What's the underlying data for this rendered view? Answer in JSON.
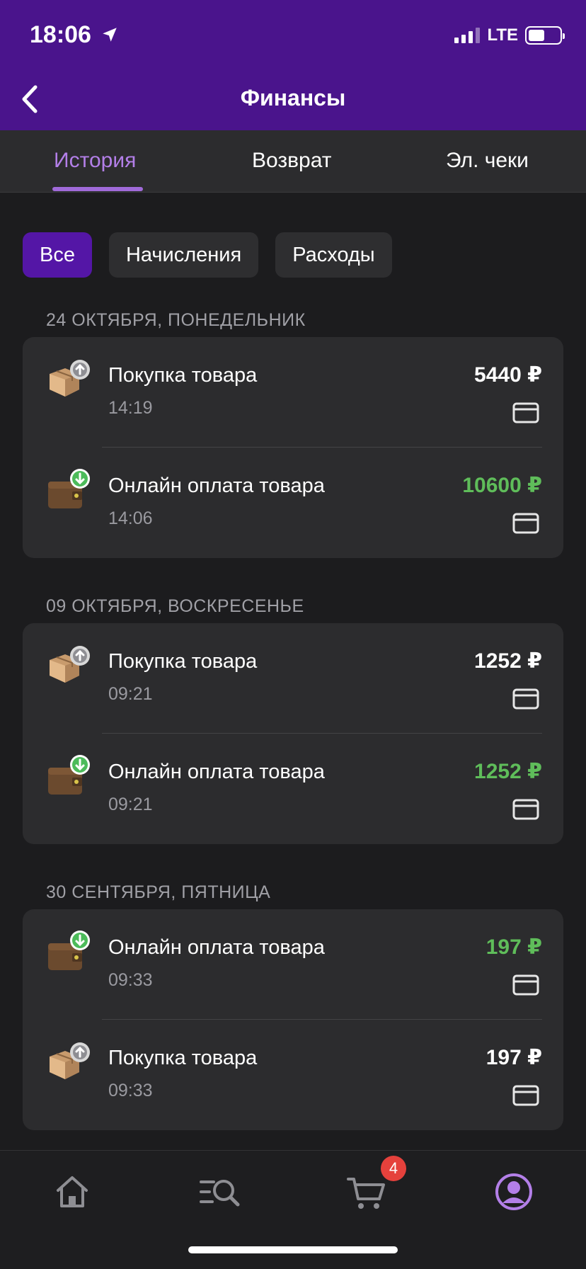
{
  "status_bar": {
    "time": "18:06",
    "network": "LTE"
  },
  "header": {
    "title": "Финансы"
  },
  "tabs": [
    {
      "label": "История",
      "active": true
    },
    {
      "label": "Возврат",
      "active": false
    },
    {
      "label": "Эл. чеки",
      "active": false
    }
  ],
  "filters": [
    {
      "label": "Все",
      "active": true
    },
    {
      "label": "Начисления",
      "active": false
    },
    {
      "label": "Расходы",
      "active": false
    }
  ],
  "sections": [
    {
      "date": "24 ОКТЯБРЯ, ПОНЕДЕЛЬНИК",
      "items": [
        {
          "type": "purchase",
          "icon": "box-upload-icon",
          "title": "Покупка товара",
          "time": "14:19",
          "amount": "5440 ₽",
          "income": false
        },
        {
          "type": "online_payment",
          "icon": "wallet-download-icon",
          "title": "Онлайн оплата товара",
          "time": "14:06",
          "amount": "10600 ₽",
          "income": true
        }
      ]
    },
    {
      "date": "09 ОКТЯБРЯ, ВОСКРЕСЕНЬЕ",
      "items": [
        {
          "type": "purchase",
          "icon": "box-upload-icon",
          "title": "Покупка товара",
          "time": "09:21",
          "amount": "1252 ₽",
          "income": false
        },
        {
          "type": "online_payment",
          "icon": "wallet-download-icon",
          "title": "Онлайн оплата товара",
          "time": "09:21",
          "amount": "1252 ₽",
          "income": true
        }
      ]
    },
    {
      "date": "30 СЕНТЯБРЯ, ПЯТНИЦА",
      "items": [
        {
          "type": "online_payment",
          "icon": "wallet-download-icon",
          "title": "Онлайн оплата товара",
          "time": "09:33",
          "amount": "197 ₽",
          "income": true
        },
        {
          "type": "purchase",
          "icon": "box-upload-icon",
          "title": "Покупка товара",
          "time": "09:33",
          "amount": "197 ₽",
          "income": false
        }
      ]
    }
  ],
  "bottom_nav": {
    "items": [
      "home-icon",
      "catalog-search-icon",
      "cart-icon",
      "profile-icon"
    ],
    "active": "profile-icon",
    "cart_badge": "4"
  },
  "colors": {
    "header": "#4a148c",
    "accent": "#b37fe8",
    "income": "#5fbd5a",
    "chip_active": "#5416a6"
  }
}
